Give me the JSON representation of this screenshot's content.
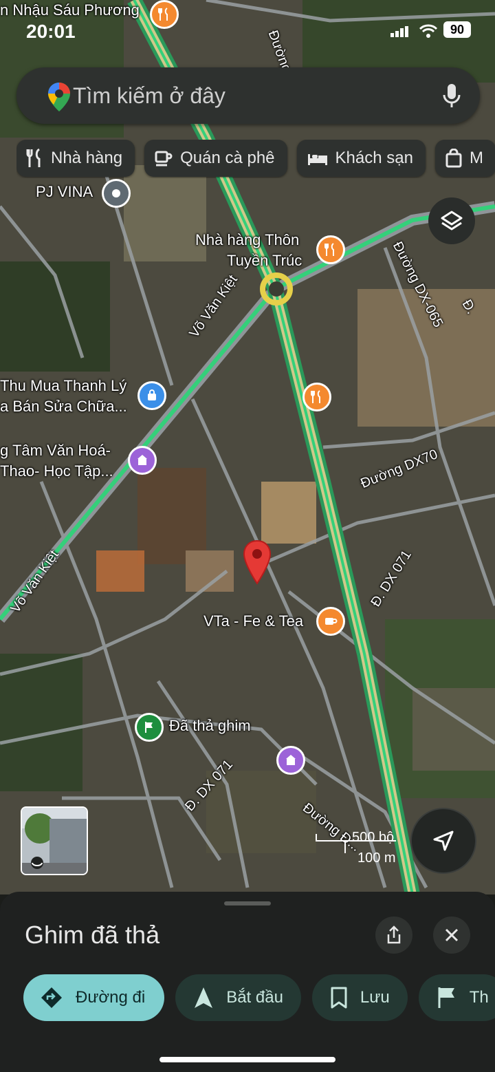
{
  "status_bar": {
    "time": "20:01",
    "battery": "90"
  },
  "search": {
    "placeholder": "Tìm kiếm ở đây"
  },
  "chips": [
    {
      "label": "Nhà hàng",
      "icon": "restaurant-icon"
    },
    {
      "label": "Quán cà phê",
      "icon": "coffee-icon"
    },
    {
      "label": "Khách sạn",
      "icon": "bed-icon"
    },
    {
      "label": "M",
      "icon": "shopping-bag-icon"
    }
  ],
  "map": {
    "labels": {
      "top_place": "n Nhậu Sáu Phương",
      "pj_vina": "PJ VINA",
      "restaurant_line1": "Nhà hàng Thôn",
      "restaurant_line2": "Tuyền Trúc",
      "shop_line1": "Thu Mua Thanh Lý",
      "shop_line2": "a Bán Sửa Chữa...",
      "center_line1": "g Tâm Văn Hoá-",
      "center_line2": "Thao- Học Tập...",
      "cafe": "VTa - Fe & Tea",
      "dropped": "Đã thả ghim",
      "road_vvk1": "Võ Văn Kiệt",
      "road_vvk2": "Võ Văn Kiệt",
      "road_dx065": "Đường DX-065",
      "road_dx70": "Đường DX70",
      "road_dx071a": "Đ. DX 071",
      "road_dx071b": "Đ. DX 071",
      "road_duong_bottom": "Đường Đ...",
      "road_duong_top": "Đường",
      "road_d_right": "Đ."
    },
    "scale": {
      "feet": "500 bộ",
      "meters": "100 m"
    }
  },
  "sheet": {
    "title": "Ghim đã thả",
    "actions": [
      {
        "label": "Đường đi",
        "icon": "directions-icon"
      },
      {
        "label": "Bắt đầu",
        "icon": "navigation-arrow-icon"
      },
      {
        "label": "Lưu",
        "icon": "bookmark-icon"
      },
      {
        "label": "Th",
        "icon": "flag-icon"
      }
    ]
  },
  "colors": {
    "road_highlight": "#34d07a",
    "pin_red": "#e53935",
    "accent_teal": "#7fcfcf",
    "poi_orange": "#f4892f",
    "poi_purple": "#9c63d8",
    "poi_blue": "#3b8fe8",
    "poi_green": "#1e8e3e"
  }
}
